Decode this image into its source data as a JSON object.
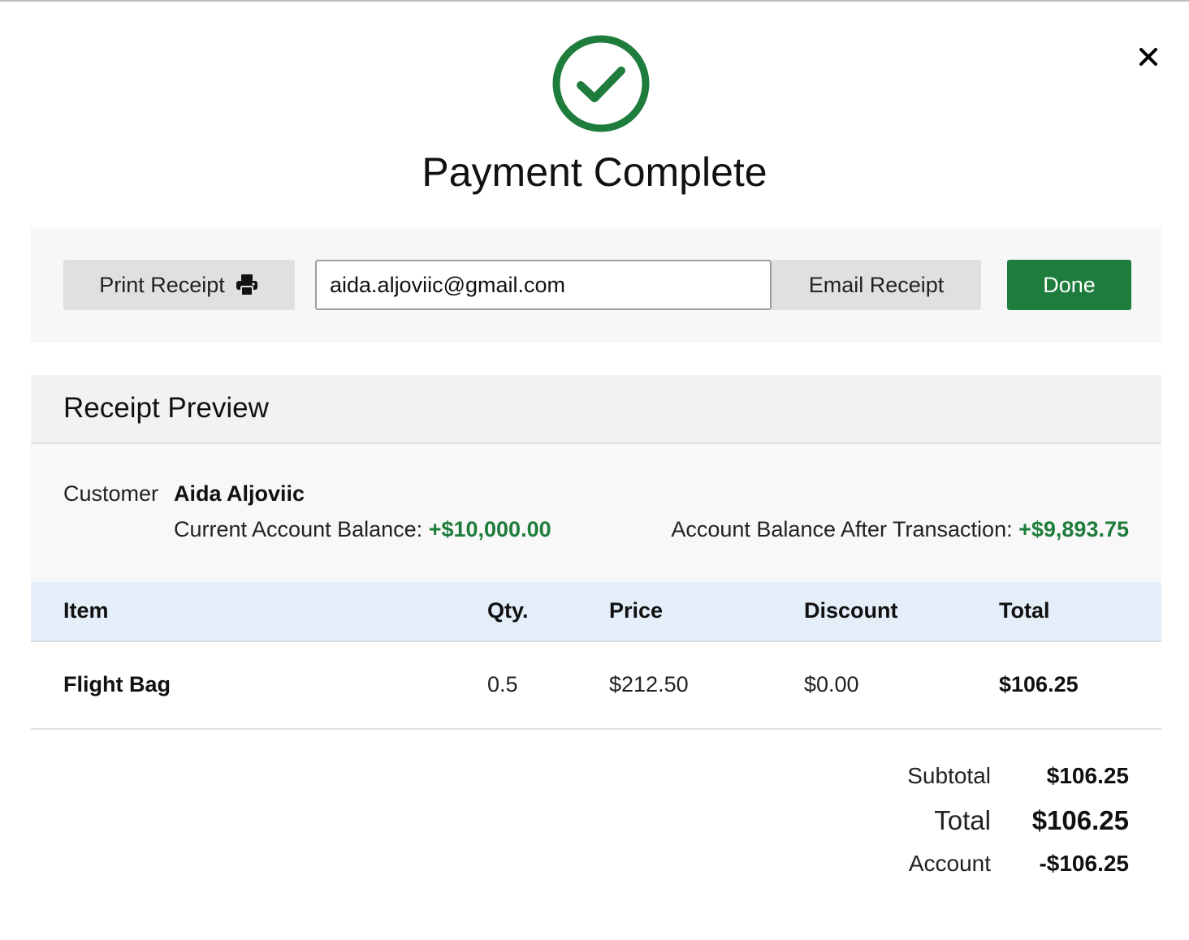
{
  "modal": {
    "title": "Payment Complete",
    "close_icon": "close-icon",
    "success_icon": "check-circle-icon",
    "accent_color": "#1e7d3c"
  },
  "actions": {
    "print_label": "Print Receipt",
    "print_icon": "printer-icon",
    "email_value": "aida.aljoviic@gmail.com",
    "email_label": "Email Receipt",
    "done_label": "Done"
  },
  "receipt": {
    "title": "Receipt Preview",
    "customer_label": "Customer",
    "customer_name": "Aida Aljoviic",
    "current_balance_label": "Current Account Balance:",
    "current_balance_value": "+$10,000.00",
    "after_balance_label": "Account Balance After Transaction:",
    "after_balance_value": "+$9,893.75"
  },
  "table": {
    "headers": {
      "item": "Item",
      "qty": "Qty.",
      "price": "Price",
      "discount": "Discount",
      "total": "Total"
    },
    "rows": [
      {
        "item": "Flight Bag",
        "qty": "0.5",
        "price": "$212.50",
        "discount": "$0.00",
        "total": "$106.25"
      }
    ]
  },
  "summary": {
    "subtotal_label": "Subtotal",
    "subtotal_value": "$106.25",
    "total_label": "Total",
    "total_value": "$106.25",
    "account_label": "Account",
    "account_value": "-$106.25"
  }
}
